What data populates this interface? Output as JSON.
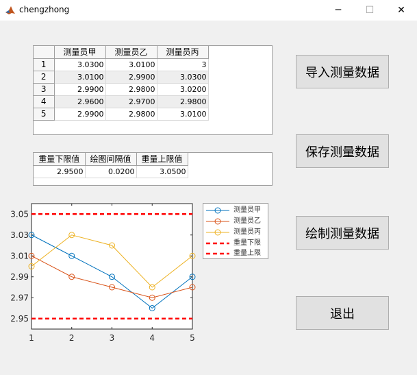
{
  "window": {
    "title": "chengzhong",
    "icon": "matlab-icon",
    "minimize_label": "─",
    "maximize_label": "☐",
    "close_label": "✕"
  },
  "data_table": {
    "columns": [
      "测量员甲",
      "测量员乙",
      "测量员丙"
    ],
    "rows": [
      {
        "row": "1",
        "values": [
          "3.0300",
          "3.0100",
          "3"
        ]
      },
      {
        "row": "2",
        "values": [
          "3.0100",
          "2.9900",
          "3.0300"
        ]
      },
      {
        "row": "3",
        "values": [
          "2.9900",
          "2.9800",
          "3.0200"
        ]
      },
      {
        "row": "4",
        "values": [
          "2.9600",
          "2.9700",
          "2.9800"
        ]
      },
      {
        "row": "5",
        "values": [
          "2.9900",
          "2.9800",
          "3.0100"
        ]
      }
    ]
  },
  "limits_table": {
    "columns": [
      "重量下限值",
      "绘图间隔值",
      "重量上限值"
    ],
    "values": [
      "2.9500",
      "0.0200",
      "3.0500"
    ]
  },
  "buttons": {
    "import": "导入测量数据",
    "save": "保存测量数据",
    "plot": "绘制测量数据",
    "exit": "退出"
  },
  "chart_data": {
    "type": "line",
    "x": [
      1,
      2,
      3,
      4,
      5
    ],
    "xticks": [
      "1",
      "2",
      "3",
      "4",
      "5"
    ],
    "yticks": [
      "2.95",
      "2.97",
      "2.99",
      "3.01",
      "3.03",
      "3.05"
    ],
    "xlim": [
      1,
      5
    ],
    "ylim": [
      2.94,
      3.06
    ],
    "series": [
      {
        "name": "测量员甲",
        "values": [
          3.03,
          3.01,
          2.99,
          2.96,
          2.99
        ],
        "color": "#0072bd",
        "style": "line-circle"
      },
      {
        "name": "测量员乙",
        "values": [
          3.01,
          2.99,
          2.98,
          2.97,
          2.98
        ],
        "color": "#d95319",
        "style": "line-circle"
      },
      {
        "name": "测量员丙",
        "values": [
          3.0,
          3.03,
          3.02,
          2.98,
          3.01
        ],
        "color": "#edb120",
        "style": "line-circle"
      },
      {
        "name": "重量下限",
        "values": [
          2.95,
          2.95,
          2.95,
          2.95,
          2.95
        ],
        "color": "#ff0000",
        "style": "dashed"
      },
      {
        "name": "重量上限",
        "values": [
          3.05,
          3.05,
          3.05,
          3.05,
          3.05
        ],
        "color": "#ff0000",
        "style": "dashed"
      }
    ],
    "legend_position": "top-right-outside",
    "grid": false
  }
}
